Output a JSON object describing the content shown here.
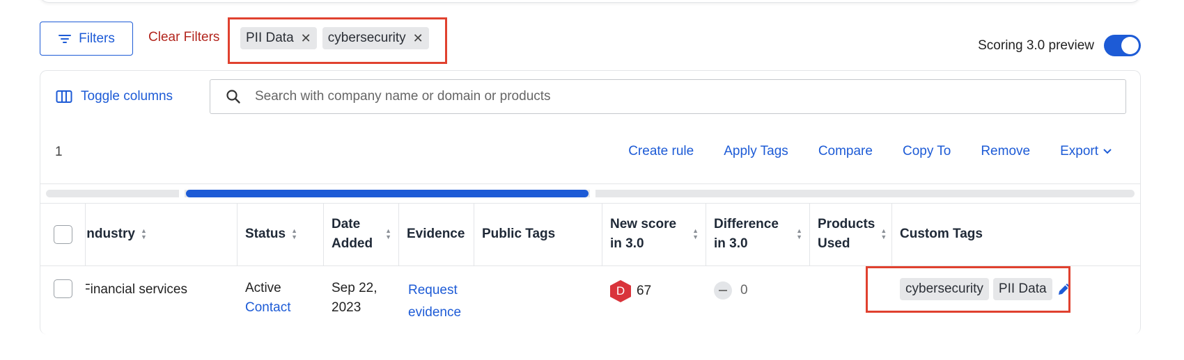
{
  "toolbar": {
    "filters_label": "Filters",
    "clear_filters_label": "Clear Filters",
    "active_filters": [
      "PII Data",
      "cybersecurity"
    ],
    "scoring_preview_label": "Scoring 3.0 preview",
    "scoring_preview_enabled": true
  },
  "table_controls": {
    "toggle_columns_label": "Toggle columns",
    "search_placeholder": "Search with company name or domain or products",
    "selected_count": "1",
    "actions": [
      "Create rule",
      "Apply Tags",
      "Compare",
      "Copy To",
      "Remove",
      "Export"
    ],
    "scroll_position": 0.28
  },
  "table": {
    "columns": {
      "industry": "Industry",
      "status": "Status",
      "date_added": "Date Added",
      "evidence": "Evidence",
      "public_tags": "Public Tags",
      "new_score": "New score in 3.0",
      "difference": "Difference in 3.0",
      "products_used": "Products Used",
      "custom_tags": "Custom Tags"
    },
    "rows": [
      {
        "industry": "Financial services",
        "status": "Active",
        "status_link": "Contact",
        "date_added": "Sep 22, 2023",
        "evidence": "Request evidence",
        "public_tags": "",
        "grade": "D",
        "new_score": "67",
        "difference": "0",
        "products_used": "",
        "custom_tags": [
          "cybersecurity",
          "PII Data"
        ]
      }
    ]
  },
  "colors": {
    "accent": "#1d5bd6",
    "danger_text": "#b3261e",
    "highlight": "#e0412f",
    "grade_d": "#d9343b"
  },
  "icons": {
    "filters": "filter-lines-icon",
    "toggle_columns": "columns-icon",
    "search": "search-icon",
    "export_caret": "chevron-down-icon",
    "edit": "pencil-icon",
    "remove_chip": "close-icon"
  }
}
